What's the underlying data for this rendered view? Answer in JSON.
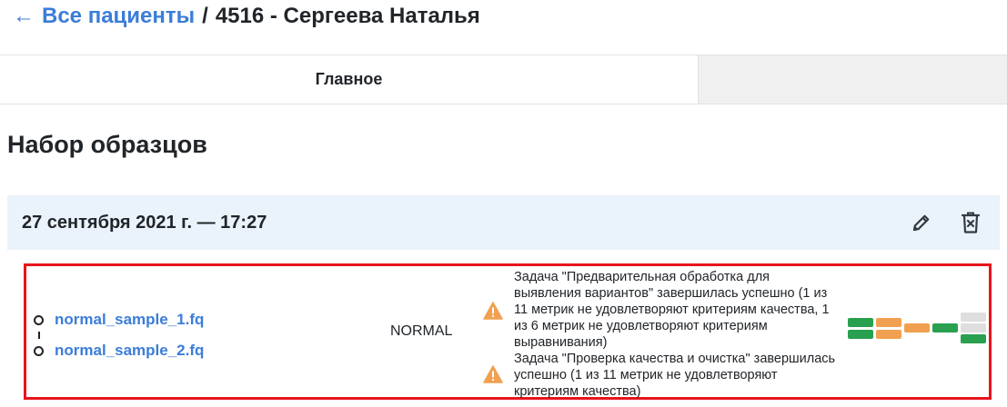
{
  "breadcrumb": {
    "arrow": "←",
    "back_label": "Все пациенты",
    "separator": "/",
    "patient_title": "4516 - Сергеева Наталья"
  },
  "tabs": {
    "main_label": "Главное"
  },
  "section": {
    "title": "Набор образцов"
  },
  "sample_set": {
    "datetime": "27 сентября 2021 г. — 17:27",
    "edit_icon": "pencil-icon",
    "delete_icon": "trash-icon"
  },
  "sample": {
    "files": [
      "normal_sample_1.fq",
      "normal_sample_2.fq"
    ],
    "type": "NORMAL",
    "tasks": [
      {
        "status_icon": "warning-icon",
        "text": "Задача \"Предварительная обработка для выявления вариантов\" завершилась успешно (1 из 11 метрик не удовлетворяют критериям качества, 1 из 6 метрик не удовлетворяют критериям выравнивания)"
      },
      {
        "status_icon": "warning-icon",
        "text": "Задача \"Проверка качества и очистка\" завершилась успешно (1 из 11 метрик не удовлетворяют критериям качества)"
      }
    ],
    "qc_colors": {
      "pass": "#28a050",
      "warn": "#f0a050",
      "pending": "#dedede"
    }
  },
  "colors": {
    "link": "#3b7dd8",
    "highlight_border": "#e8141c",
    "header_bg": "#eaf2fb",
    "warning": "#f0a050"
  }
}
